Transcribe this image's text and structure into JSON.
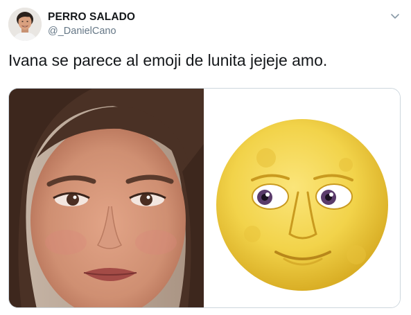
{
  "tweet": {
    "display_name": "PERRO SALADO",
    "handle": "@_DanielCano",
    "text": "Ivana se parece al emoji de lunita jejeje amo.",
    "avatar_icon": "user-avatar-photo",
    "menu_icon": "chevron-down-icon"
  },
  "media": {
    "left_image": "woman-face-photo",
    "right_image": "full-moon-face-emoji"
  },
  "colors": {
    "name": "#14171a",
    "handle": "#657786",
    "border": "#ccd6dd",
    "moon": "#f2d34a"
  }
}
